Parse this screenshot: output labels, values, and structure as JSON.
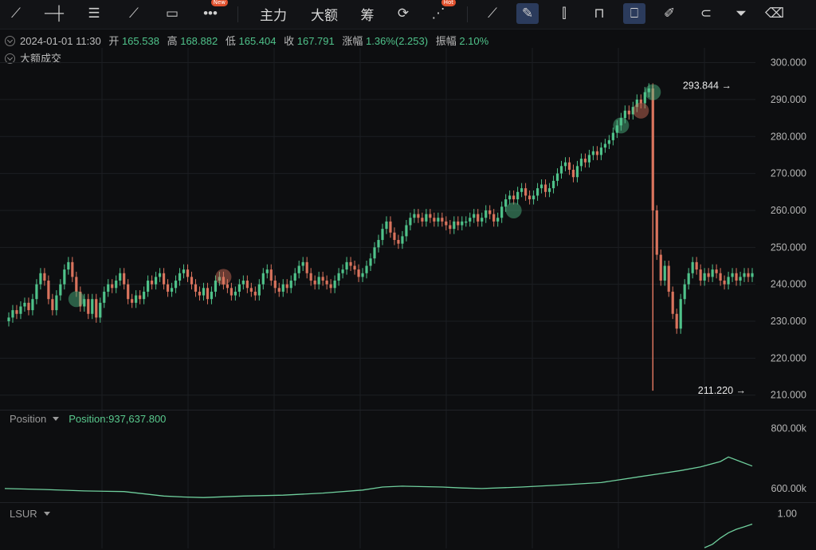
{
  "toolbar": {
    "tools": [
      {
        "icon": "trend-line-icon",
        "glyph": "⟋"
      },
      {
        "icon": "horizontal-line-icon",
        "glyph": "─┼"
      },
      {
        "icon": "parallel-lines-icon",
        "glyph": "☰"
      },
      {
        "icon": "ruler-pen-icon",
        "glyph": "⟋"
      },
      {
        "icon": "rectangle-icon",
        "glyph": "▭"
      },
      {
        "icon": "more-icon",
        "glyph": "•••",
        "badge": "New"
      }
    ],
    "text_buttons": [
      "主力",
      "大额",
      "筹"
    ],
    "tools_right": [
      {
        "icon": "camera-icon",
        "glyph": "⟳"
      },
      {
        "icon": "pattern-icon",
        "glyph": "⋰",
        "badge": "Hot"
      },
      {
        "icon": "measure-icon",
        "glyph": "⟋"
      },
      {
        "icon": "draw-pen-icon",
        "glyph": "✎",
        "active": true
      },
      {
        "icon": "candles-icon",
        "glyph": "⫿"
      },
      {
        "icon": "lock-icon",
        "glyph": "⊓"
      },
      {
        "icon": "bookmark-icon",
        "glyph": "⎕",
        "active": true
      },
      {
        "icon": "note-icon",
        "glyph": "✐"
      },
      {
        "icon": "magnet-icon",
        "glyph": "⊂"
      },
      {
        "icon": "filter-icon",
        "glyph": "⏷"
      },
      {
        "icon": "trash-icon",
        "glyph": "⌫"
      }
    ]
  },
  "info": {
    "datetime": "2024-01-01 11:30",
    "open_label": "开",
    "open": "165.538",
    "high_label": "高",
    "high": "168.882",
    "low_label": "低",
    "low": "165.404",
    "close_label": "收",
    "close": "167.791",
    "change_label": "涨幅",
    "change": "1.36%(2.253)",
    "amplitude_label": "振幅",
    "amplitude": "2.10%",
    "indicator": "大额成交"
  },
  "colors": {
    "up": "#4fc28a",
    "down": "#d9735d",
    "line": "#6fcf9d",
    "bg": "#0d0e10",
    "grid": "#1c1e22"
  },
  "chart_data": [
    {
      "type": "line",
      "name": "price",
      "yticks": [
        "300.000",
        "290.000",
        "280.000",
        "270.000",
        "260.000",
        "250.000",
        "240.000",
        "230.000",
        "220.000",
        "210.000"
      ],
      "ylim": [
        208,
        304
      ],
      "x": [
        0,
        1,
        2,
        3,
        4,
        5,
        6,
        7,
        8,
        9,
        10,
        11,
        12,
        13,
        14,
        15,
        16,
        17,
        18,
        19,
        20,
        21,
        22,
        23,
        24,
        25,
        26,
        27,
        28,
        29,
        30,
        31,
        32,
        33,
        34,
        35,
        36,
        37,
        38,
        39,
        40,
        41,
        42,
        43,
        44,
        45,
        46,
        47,
        48,
        49,
        50,
        51,
        52,
        53,
        54,
        55,
        56,
        57,
        58,
        59,
        60,
        61,
        62,
        63,
        64,
        65,
        66,
        67,
        68,
        69,
        70,
        71,
        72,
        73,
        74,
        75,
        76,
        77,
        78,
        79,
        80,
        81,
        82,
        83,
        84,
        85,
        86,
        87,
        88,
        89,
        90,
        91,
        92,
        93,
        94,
        95,
        96,
        97,
        98,
        99,
        100,
        101,
        102,
        103,
        104,
        105,
        106,
        107,
        108,
        109,
        110,
        111,
        112,
        113,
        114,
        115,
        116,
        117,
        118,
        119,
        120,
        121,
        122,
        123,
        124,
        125,
        126,
        127,
        128,
        129,
        130,
        131,
        132,
        133,
        134,
        135,
        136,
        137,
        138,
        139,
        140,
        141,
        142,
        143,
        144,
        145,
        146,
        147,
        148,
        149,
        150,
        151,
        152,
        153,
        154,
        155,
        156,
        157,
        158,
        159,
        160,
        161,
        162,
        163,
        164,
        165,
        166,
        167,
        168,
        169,
        170,
        171,
        172,
        173,
        174,
        175,
        176,
        177,
        178,
        179,
        180,
        181,
        182,
        183,
        184,
        185,
        186,
        187,
        188
      ],
      "y": [
        230,
        231,
        233,
        232,
        234,
        235,
        233,
        236,
        240,
        243,
        241,
        236,
        233,
        237,
        240,
        244,
        246,
        242,
        238,
        234,
        236,
        232,
        236,
        231,
        235,
        238,
        240,
        239,
        241,
        243,
        240,
        236,
        235,
        237,
        236,
        238,
        241,
        240,
        242,
        243,
        240,
        238,
        239,
        241,
        243,
        244,
        242,
        240,
        238,
        237,
        239,
        236,
        238,
        241,
        242,
        240,
        239,
        237,
        238,
        240,
        241,
        239,
        238,
        237,
        240,
        243,
        244,
        241,
        239,
        238,
        240,
        239,
        241,
        243,
        245,
        246,
        243,
        241,
        240,
        242,
        241,
        240,
        239,
        241,
        243,
        244,
        246,
        245,
        244,
        242,
        243,
        245,
        247,
        250,
        252,
        255,
        257,
        254,
        252,
        251,
        253,
        256,
        258,
        259,
        258,
        257,
        259,
        258,
        257,
        258,
        257,
        256,
        255,
        257,
        256,
        257,
        257,
        258,
        259,
        257,
        258,
        260,
        259,
        257,
        258,
        261,
        263,
        264,
        263,
        265,
        266,
        264,
        263,
        264,
        266,
        267,
        265,
        266,
        268,
        270,
        272,
        273,
        271,
        269,
        272,
        274,
        273,
        275,
        276,
        275,
        277,
        278,
        279,
        281,
        283,
        285,
        287,
        286,
        288,
        290,
        289,
        292,
        293,
        260,
        248,
        241,
        245,
        238,
        232,
        228,
        236,
        240,
        243,
        246,
        244,
        241,
        243,
        242,
        244,
        243,
        241,
        240,
        242,
        243,
        241,
        242,
        243,
        242,
        243
      ],
      "max_label": "293.844",
      "min_label": "211.220"
    },
    {
      "type": "line",
      "name": "Position",
      "value_label": "Position:937,637.800",
      "yticks": [
        "800.00k",
        "600.00k"
      ],
      "ylim": [
        560,
        820
      ],
      "x": [
        0,
        10,
        20,
        30,
        40,
        45,
        50,
        60,
        70,
        80,
        90,
        95,
        100,
        110,
        115,
        120,
        130,
        140,
        150,
        160,
        165,
        170,
        175,
        180,
        182,
        185,
        188
      ],
      "y": [
        600,
        597,
        592,
        590,
        575,
        572,
        570,
        575,
        578,
        585,
        595,
        605,
        608,
        605,
        602,
        600,
        605,
        612,
        620,
        640,
        650,
        660,
        672,
        690,
        705,
        690,
        675
      ]
    },
    {
      "type": "line",
      "name": "LSUR",
      "yticks": [
        "1.00"
      ],
      "ylim": [
        0,
        1.1
      ],
      "x": [
        176,
        178,
        180,
        182,
        184,
        186,
        188
      ],
      "y": [
        0.02,
        0.12,
        0.3,
        0.45,
        0.55,
        0.62,
        0.7
      ]
    }
  ],
  "labels": {
    "panel2": "Position",
    "panel3": "LSUR"
  }
}
